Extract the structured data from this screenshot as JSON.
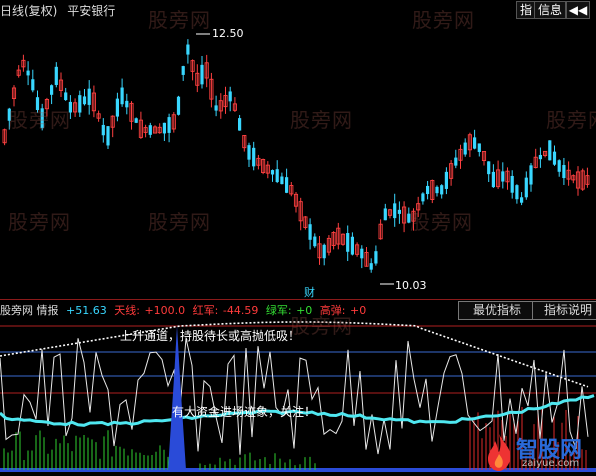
{
  "header": {
    "title": "日线(复权)",
    "stock_name": "平安银行",
    "buttons": [
      {
        "label": "指"
      },
      {
        "label": "信息"
      }
    ],
    "nav_icon": "back-arrows-icon"
  },
  "price_chart": {
    "high_label": "12.50",
    "low_label": "10.03",
    "marker_char": "财",
    "up_color": "#ff4040",
    "down_color": "#39d7ff"
  },
  "indicator": {
    "name": "股旁网 情报",
    "values": [
      {
        "label": "+51.63",
        "color": "#39d7ff"
      },
      {
        "label": "天线:",
        "color": "#ff3b3b"
      },
      {
        "label": "+100.0",
        "color": "#ff3b3b"
      },
      {
        "label": "红军:",
        "color": "#ff3b3b"
      },
      {
        "label": "-44.59",
        "color": "#ff3b3b"
      },
      {
        "label": "绿军:",
        "color": "#33dd33"
      },
      {
        "label": "+0",
        "color": "#33dd33"
      },
      {
        "label": "高弹:",
        "color": "#ff3b3b"
      },
      {
        "label": "+0",
        "color": "#ff3b3b"
      }
    ],
    "tabs": [
      {
        "label": "最优指标"
      },
      {
        "label": "指标说明"
      }
    ],
    "annotations": {
      "channel": "上升通道，持股待长或高抛低吸！",
      "funds": "有大资金进场迹象，关注！"
    }
  },
  "watermarks": [
    "股旁网",
    "股旁网",
    "股旁网",
    "股旁网",
    "股旁网",
    "股旁网",
    "股旁网",
    "股旁网",
    "股旁网"
  ],
  "logo": {
    "name": "智股网",
    "url_text": "zaiyue.com",
    "icon": "flame-logo-icon"
  }
}
